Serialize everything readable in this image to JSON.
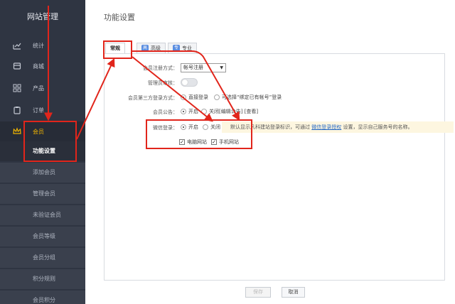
{
  "sidebar": {
    "title": "网站管理",
    "items": [
      {
        "label": "统计",
        "icon": "chart-line-icon"
      },
      {
        "label": "商城",
        "icon": "store-icon"
      },
      {
        "label": "产品",
        "icon": "grid-icon"
      },
      {
        "label": "订单",
        "icon": "clipboard-icon"
      },
      {
        "label": "会员",
        "icon": "crown-icon"
      }
    ],
    "member_sub": [
      "功能设置",
      "添加会员",
      "管理会员",
      "未验证会员",
      "会员等级",
      "会员分组",
      "积分规则",
      "会员积分"
    ]
  },
  "page_title": "功能设置",
  "tabs": [
    {
      "label": "常规",
      "badge": ""
    },
    {
      "label": "高级",
      "badge": "高"
    },
    {
      "label": "专业",
      "badge": "专"
    }
  ],
  "form": {
    "register_label": "会员注册方式：",
    "register_value": "帐号注册",
    "approve_label": "管理员审核：",
    "third_label": "会员第三方登录方式：",
    "third_opt1": "直接登录",
    "third_opt2": "可选择“绑定已有帐号”登录",
    "notice_label": "会员公告：",
    "notice_on": "开启",
    "notice_off": "关闭",
    "notice_edit": "[编辑公告] [查看]",
    "wechat_label": "微信登录：",
    "wechat_on": "开启",
    "wechat_off": "关闭",
    "wechat_pc": "电脑网站",
    "wechat_mobile": "手机网站",
    "hint_pre": "默认显示凡科建站登录标识，可通过",
    "hint_link": "微信登录授权",
    "hint_post": "设置，显示自己服务号的名称。"
  },
  "buttons": {
    "save": "保存",
    "cancel": "取消"
  },
  "colors": {
    "sidebar_bg": "#2f3542",
    "accent_member": "#f0b400",
    "annotation_red": "#e1251b",
    "link": "#2b6cc4"
  }
}
